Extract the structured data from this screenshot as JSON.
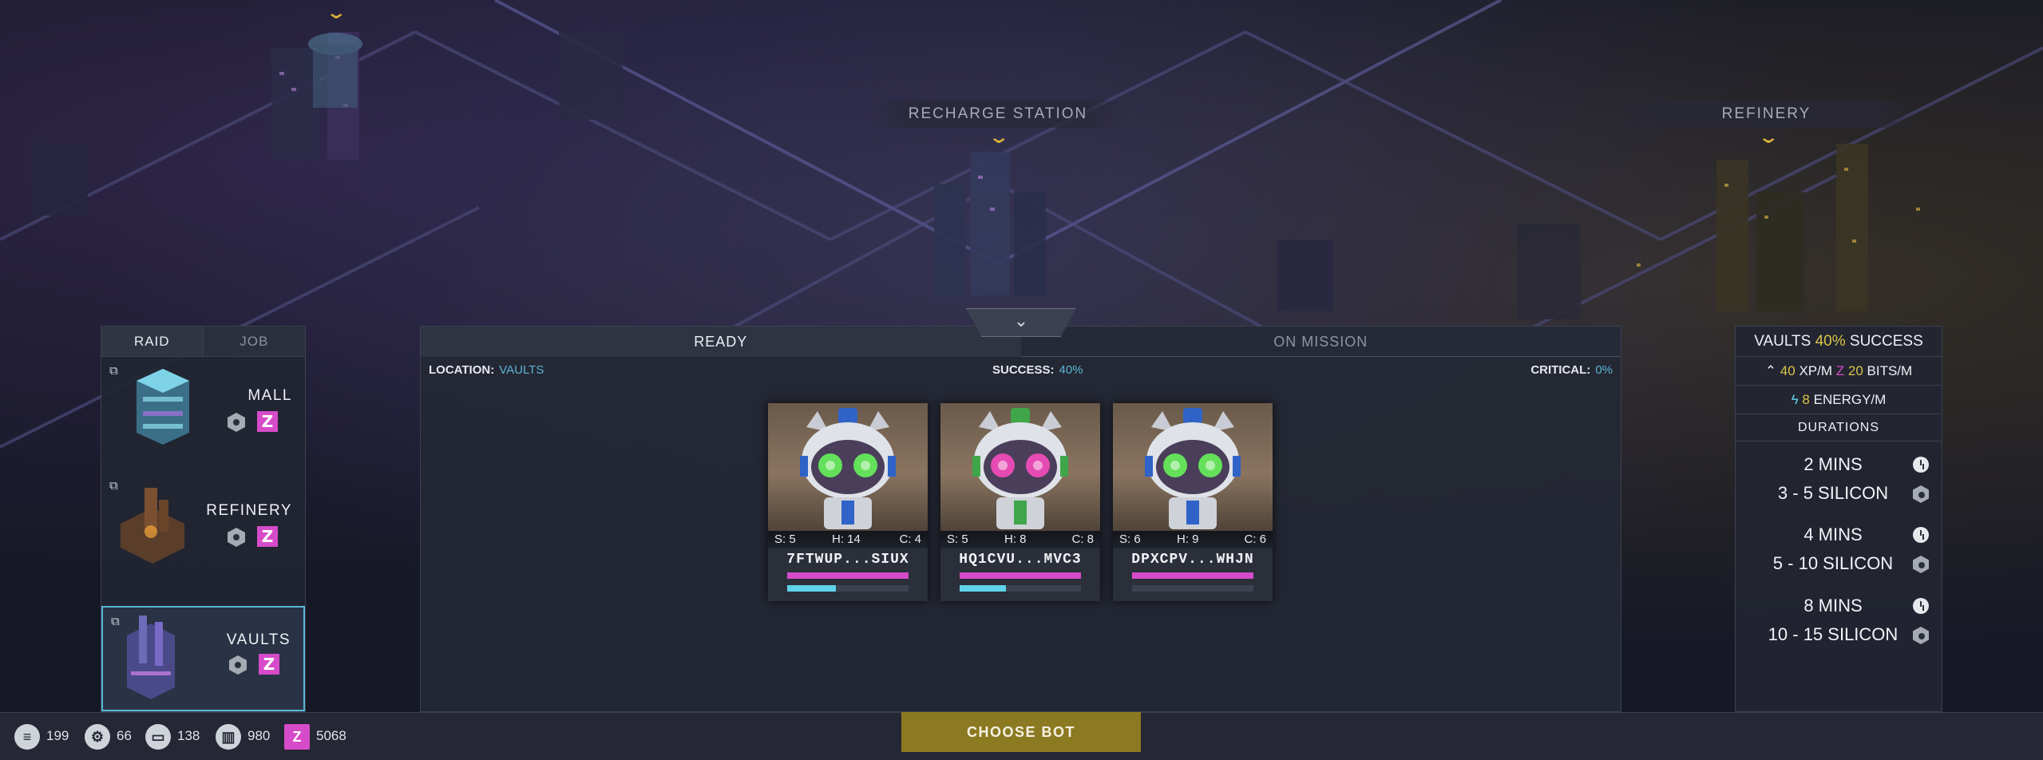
{
  "map": {
    "labels": [
      {
        "name": "recharge-station",
        "text": "RECHARGE STATION"
      },
      {
        "name": "refinery",
        "text": "REFINERY"
      }
    ]
  },
  "location_panel": {
    "tabs": [
      "RAID",
      "JOB"
    ],
    "active_tab": "RAID",
    "locations": [
      {
        "name": "MALL",
        "selected": false
      },
      {
        "name": "REFINERY",
        "selected": false
      },
      {
        "name": "VAULTS",
        "selected": true
      }
    ]
  },
  "mission_panel": {
    "tabs": [
      "READY",
      "ON MISSION"
    ],
    "active_tab": "READY",
    "location_label": "LOCATION:",
    "location_value": "VAULTS",
    "success_label": "SUCCESS:",
    "success_value": "40%",
    "critical_label": "CRITICAL:",
    "critical_value": "0%",
    "bots": [
      {
        "id": "7FTWUP...SIUX",
        "s": "S: 5",
        "h": "H: 14",
        "c": "C: 4",
        "eye_color": "#64e05a",
        "accent": "#2f63c8",
        "health": 1.0,
        "energy": 0.4
      },
      {
        "id": "HQ1CVU...MVC3",
        "s": "S: 5",
        "h": "H: 8",
        "c": "C: 8",
        "eye_color": "#e64bb3",
        "accent": "#3fa64a",
        "health": 1.0,
        "energy": 0.38
      },
      {
        "id": "DPXCPV...WHJN",
        "s": "S: 6",
        "h": "H: 9",
        "c": "C: 6",
        "eye_color": "#64e05a",
        "accent": "#2f63c8",
        "health": 1.0,
        "energy": 0.0
      }
    ]
  },
  "info_panel": {
    "title_location": "VAULTS",
    "title_pct": "40%",
    "title_word": "SUCCESS",
    "xp_value": "40",
    "xp_unit": "XP/M",
    "bits_value": "20",
    "bits_unit": "BITS/M",
    "energy_value": "8",
    "energy_unit": "ENERGY/M",
    "durations_label": "DURATIONS",
    "durations": [
      {
        "time": "2 MINS",
        "reward": "3 - 5 SILICON"
      },
      {
        "time": "4 MINS",
        "reward": "5 - 10 SILICON"
      },
      {
        "time": "8 MINS",
        "reward": "10 - 15 SILICON"
      }
    ]
  },
  "resources": [
    {
      "icon": "database-icon",
      "value": "199"
    },
    {
      "icon": "gear-icon",
      "value": "66"
    },
    {
      "icon": "chip-icon",
      "value": "138"
    },
    {
      "icon": "trash-icon",
      "value": "980"
    },
    {
      "icon": "bits-icon",
      "value": "5068"
    }
  ],
  "choose_bot_label": "CHOOSE BOT",
  "colors": {
    "accent_blue": "#5bb4d4",
    "bits_pink": "#d64bc9",
    "gold": "#8c7a22",
    "health_bar": "#d64bc9",
    "energy_bar": "#5fd3ea"
  }
}
